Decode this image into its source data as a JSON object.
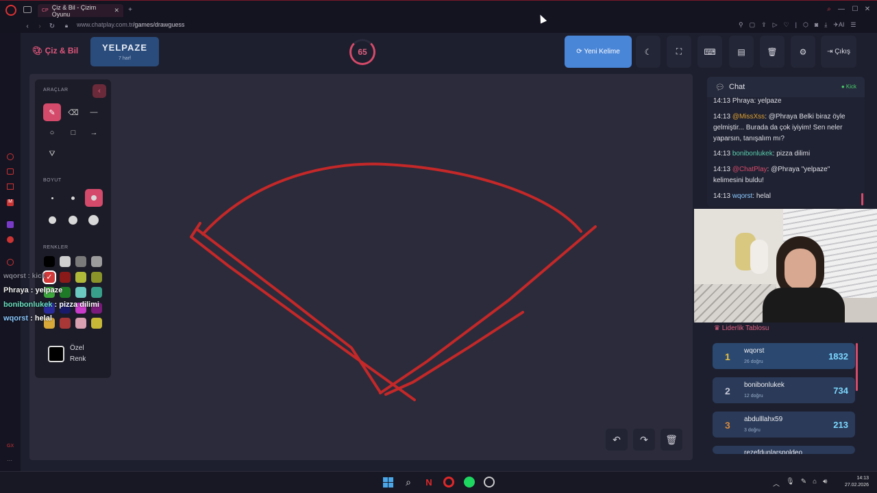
{
  "browser": {
    "tab_title": "Çiz & Bil - Çizim Oyunu",
    "tab_favicon": "CP",
    "url_host": "www.chatplay.com.tr",
    "url_path": "/games/drawguess",
    "ai_label": "AI"
  },
  "header": {
    "logo": "Çiz & Bil",
    "word": "YELPAZE",
    "word_hint": "7 harf",
    "timer": "65",
    "new_word": "Yeni Kelime",
    "exit": "Çıkış"
  },
  "tools": {
    "tools_title": "ARAÇLAR",
    "size_title": "BOYUT",
    "colors_title": "RENKLER",
    "custom_color": "Özel",
    "custom_color2": "Renk"
  },
  "palette": [
    "#000000",
    "#cfcfcf",
    "#7a7a7a",
    "#9c9c9c",
    "#d33a3a",
    "#8a1a1a",
    "#b0b83a",
    "#8a9428",
    "#3ca83c",
    "#1f7a28",
    "#6ac8c0",
    "#38a08a",
    "#2a2a9a",
    "#1a1a6a",
    "#c83ac8",
    "#7a1a7a",
    "#d8a838",
    "#a83838",
    "#d8a0b0",
    "#c8b838"
  ],
  "overlay_chat": [
    {
      "user": "wqorst",
      "text": "kick"
    },
    {
      "user": "Phraya",
      "text": "yelpaze"
    },
    {
      "user": "bonibonlukek",
      "text": "pizza dilimi"
    },
    {
      "user": "wqorst",
      "text": "helal"
    }
  ],
  "chat": {
    "title": "Chat",
    "platform": "Kick",
    "messages": [
      {
        "time": "14:13",
        "user": "Phraya",
        "text": ": yelpaze"
      },
      {
        "time": "14:13",
        "user": "@MissXss",
        "text": ": @Phraya Belki biraz öyle gelmiştir... Burada da çok iyiyim! Sen neler yaparsın, tanışalım mı?"
      },
      {
        "time": "14:13",
        "user": "bonibonlukek",
        "text": ": pizza dilimi"
      },
      {
        "time": "14:13",
        "user": "@ChatPlay",
        "text": ": @Phraya \"yelpaze\" kelimesini buldu!"
      },
      {
        "time": "14:13",
        "user": "wqorst",
        "text": ": helal"
      }
    ]
  },
  "leaderboard": {
    "title": "Liderlik Tablosu",
    "rows": [
      {
        "rank": "1",
        "name": "wqorst",
        "sub": "26 doğru",
        "score": "1832"
      },
      {
        "rank": "2",
        "name": "bonibonlukek",
        "sub": "12 doğru",
        "score": "734"
      },
      {
        "rank": "3",
        "name": "abdulllahx59",
        "sub": "3 doğru",
        "score": "213"
      },
      {
        "rank": "",
        "name": "rezefdunlarspoldeo",
        "sub": "",
        "score": ""
      }
    ]
  },
  "taskbar": {
    "time": "14:13",
    "date": "27.02.2026"
  },
  "colors": {
    "accent": "#d44a6a",
    "brand_blue": "#4a86d8",
    "stroke": "#c42828"
  }
}
